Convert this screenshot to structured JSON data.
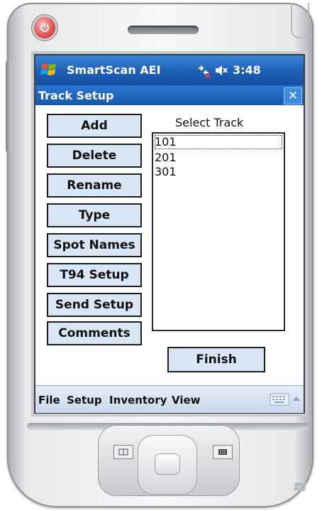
{
  "status_bar": {
    "app_title": "SmartScan AEI",
    "time": "3:48",
    "icons": [
      "windows-flag-icon",
      "connectivity-icon",
      "volume-muted-icon"
    ]
  },
  "window": {
    "title": "Track Setup",
    "close_label": "✕"
  },
  "buttons": [
    {
      "label": "Add"
    },
    {
      "label": "Delete"
    },
    {
      "label": "Rename"
    },
    {
      "label": "Type"
    },
    {
      "label": "Spot Names"
    },
    {
      "label": "T94 Setup"
    },
    {
      "label": "Send Setup"
    },
    {
      "label": "Comments"
    }
  ],
  "track_list": {
    "label": "Select Track",
    "items": [
      "101",
      "201",
      "301"
    ],
    "selected": "101"
  },
  "finish_label": "Finish",
  "menu": [
    "File",
    "Setup",
    "Inventory",
    "View"
  ],
  "colors": {
    "status_bar_blue": "#1c5fb4",
    "button_fill": "#d9e6f5",
    "menu_bar": "#d6e2f2"
  }
}
